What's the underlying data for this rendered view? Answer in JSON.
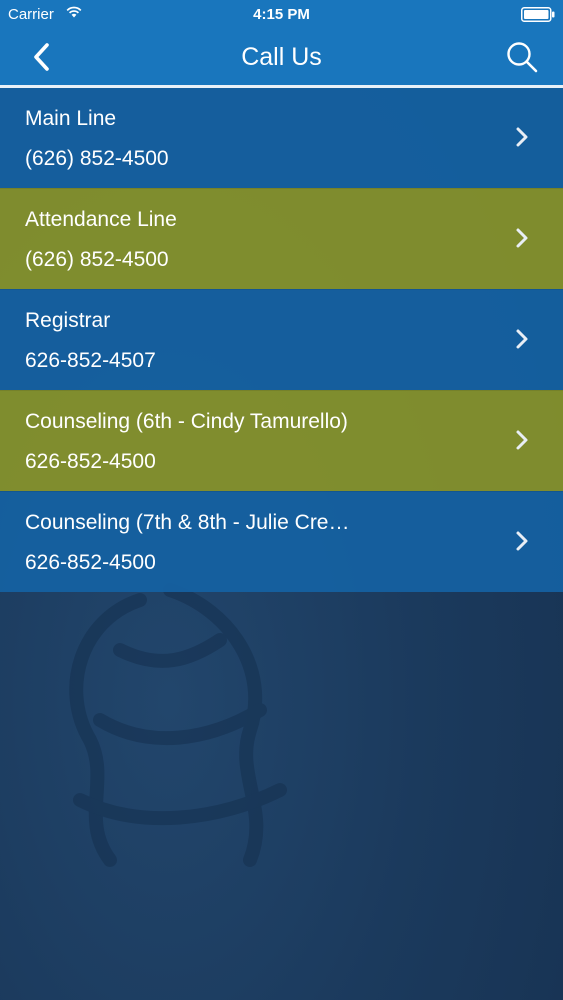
{
  "status_bar": {
    "carrier": "Carrier",
    "time": "4:15 PM",
    "icons": [
      "wifi-icon",
      "battery-icon"
    ]
  },
  "nav": {
    "title": "Call Us",
    "back_icon": "chevron-left-icon",
    "search_icon": "search-icon"
  },
  "contacts": [
    {
      "name": "Main Line",
      "phone": "(626) 852-4500",
      "style": "blue"
    },
    {
      "name": "Attendance Line",
      "phone": "(626) 852-4500",
      "style": "olive"
    },
    {
      "name": "Registrar",
      "phone": "626-852-4507",
      "style": "blue"
    },
    {
      "name": "Counseling (6th - Cindy Tamurello)",
      "phone": "626-852-4500",
      "style": "olive"
    },
    {
      "name": "Counseling (7th & 8th - Julie Cre…",
      "phone": "626-852-4500",
      "style": "blue"
    }
  ],
  "colors": {
    "nav_blue": "#1976bd",
    "row_blue": "#1562a3",
    "row_olive": "#838f2c",
    "background": "#1c3a5e"
  }
}
